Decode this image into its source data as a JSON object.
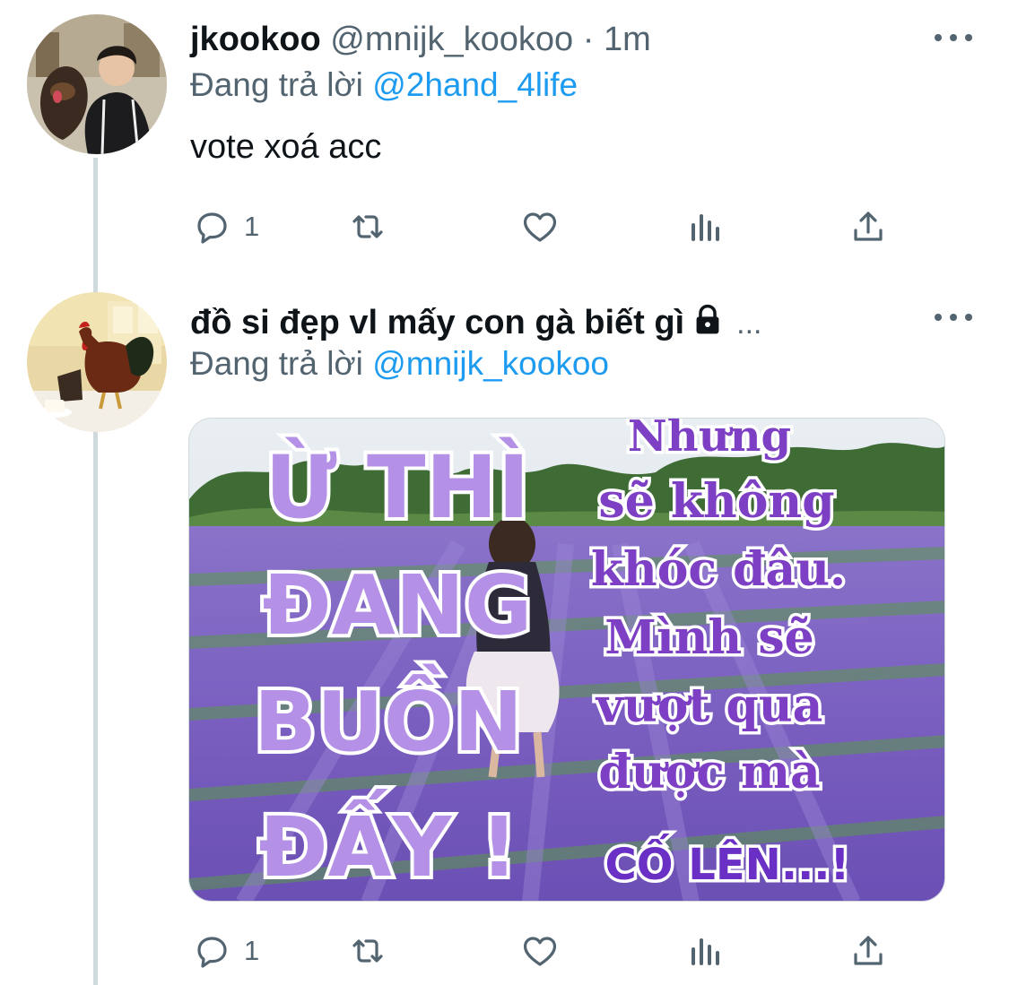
{
  "tweets": [
    {
      "display_name": "jkookoo",
      "handle": "@mnijk_kookoo",
      "separator": "·",
      "time": "1m",
      "reply_prefix": "Đang trả lời",
      "reply_to": "@2hand_4life",
      "text": "vote xoá acc",
      "avatar_icon": "avatar-person-with-dog",
      "actions": {
        "reply_count": "1",
        "retweet_count": "",
        "like_count": ""
      }
    },
    {
      "display_name": "đồ si đẹp vl mấy con gà biết gì",
      "name_suffix": "...",
      "locked_icon": "lock-icon",
      "reply_prefix": "Đang trả lời",
      "reply_to": "@mnijk_kookoo",
      "avatar_icon": "avatar-rooster",
      "media": {
        "left_lines": [
          "Ừ THÌ",
          "ĐANG",
          "BUỒN",
          "ĐẤY !"
        ],
        "right_lines": [
          "Nhưng",
          "sẽ không",
          "khóc đâu.",
          "Mình sẽ",
          "vượt qua",
          "được mà"
        ],
        "call_to_action": "CỐ LÊN...!"
      },
      "actions": {
        "reply_count": "1",
        "retweet_count": "",
        "like_count": ""
      }
    }
  ],
  "colors": {
    "text_primary": "#0f1419",
    "text_secondary": "#536471",
    "accent": "#1d9bf0",
    "thread_line": "#cfd9de"
  }
}
